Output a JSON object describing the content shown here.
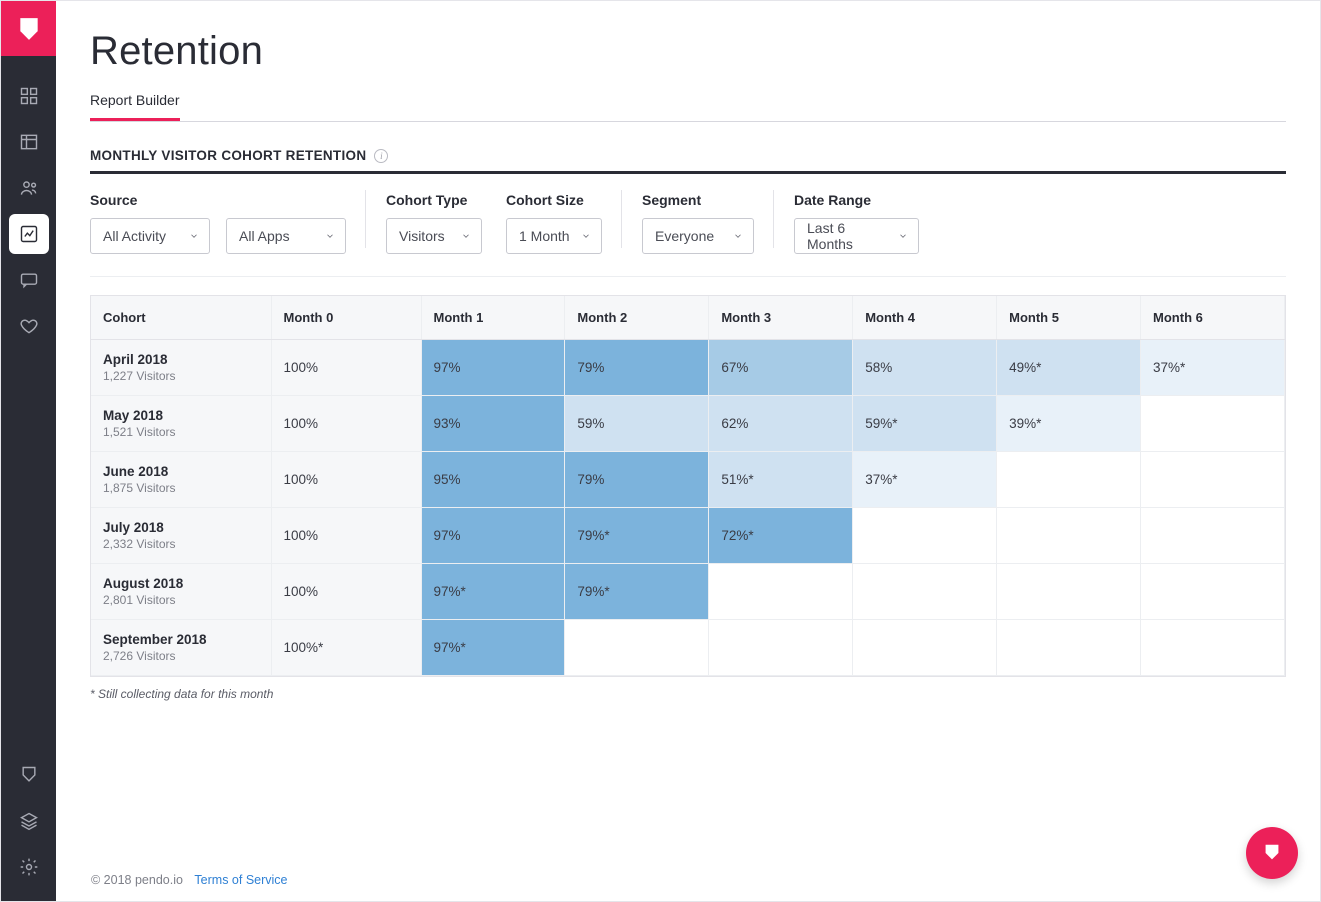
{
  "sidebar": {
    "top_items": [
      "dashboard",
      "charts",
      "users",
      "trend",
      "chat",
      "heart"
    ],
    "bottom_items": [
      "pendo",
      "layers",
      "settings"
    ],
    "active": "trend"
  },
  "header": {
    "title": "Retention"
  },
  "tabs": {
    "items": [
      "Report Builder"
    ],
    "active": 0
  },
  "section": {
    "title": "MONTHLY VISITOR COHORT RETENTION"
  },
  "filters": {
    "labels": {
      "source": "Source",
      "cohort_type": "Cohort Type",
      "cohort_size": "Cohort Size",
      "segment": "Segment",
      "date_range": "Date Range"
    },
    "values": {
      "source_activity": "All Activity",
      "source_apps": "All Apps",
      "cohort_type": "Visitors",
      "cohort_size": "1 Month",
      "segment": "Everyone",
      "date_range": "Last 6 Months"
    }
  },
  "table": {
    "columns": [
      "Cohort",
      "Month 0",
      "Month 1",
      "Month 2",
      "Month 3",
      "Month 4",
      "Month 5",
      "Month 6"
    ],
    "rows": [
      {
        "cohort": "April 2018",
        "sub": "1,227 Visitors",
        "cells": [
          "100%",
          "97%",
          "79%",
          "67%",
          "58%",
          "49%*",
          "37%*"
        ],
        "shades": [
          "",
          "a",
          "a",
          "b",
          "c",
          "c",
          "d"
        ]
      },
      {
        "cohort": "May 2018",
        "sub": "1,521 Visitors",
        "cells": [
          "100%",
          "93%",
          "59%",
          "62%",
          "59%*",
          "39%*",
          ""
        ],
        "shades": [
          "",
          "a",
          "c",
          "c",
          "c",
          "d",
          ""
        ]
      },
      {
        "cohort": "June 2018",
        "sub": "1,875 Visitors",
        "cells": [
          "100%",
          "95%",
          "79%",
          "51%*",
          "37%*",
          "",
          ""
        ],
        "shades": [
          "",
          "a",
          "a",
          "c",
          "d",
          "",
          ""
        ]
      },
      {
        "cohort": "July 2018",
        "sub": "2,332 Visitors",
        "cells": [
          "100%",
          "97%",
          "79%*",
          "72%*",
          "",
          "",
          ""
        ],
        "shades": [
          "",
          "a",
          "a",
          "a",
          "",
          "",
          ""
        ]
      },
      {
        "cohort": "August 2018",
        "sub": "2,801 Visitors",
        "cells": [
          "100%",
          "97%*",
          "79%*",
          "",
          "",
          "",
          ""
        ],
        "shades": [
          "",
          "a",
          "a",
          "",
          "",
          "",
          ""
        ]
      },
      {
        "cohort": "September 2018",
        "sub": "2,726 Visitors",
        "cells": [
          "100%*",
          "97%*",
          "",
          "",
          "",
          "",
          ""
        ],
        "shades": [
          "",
          "a",
          "",
          "",
          "",
          "",
          ""
        ]
      }
    ],
    "footnote": "* Still collecting data for this month"
  },
  "footer": {
    "copyright": "© 2018 pendo.io",
    "tos": "Terms of Service"
  }
}
